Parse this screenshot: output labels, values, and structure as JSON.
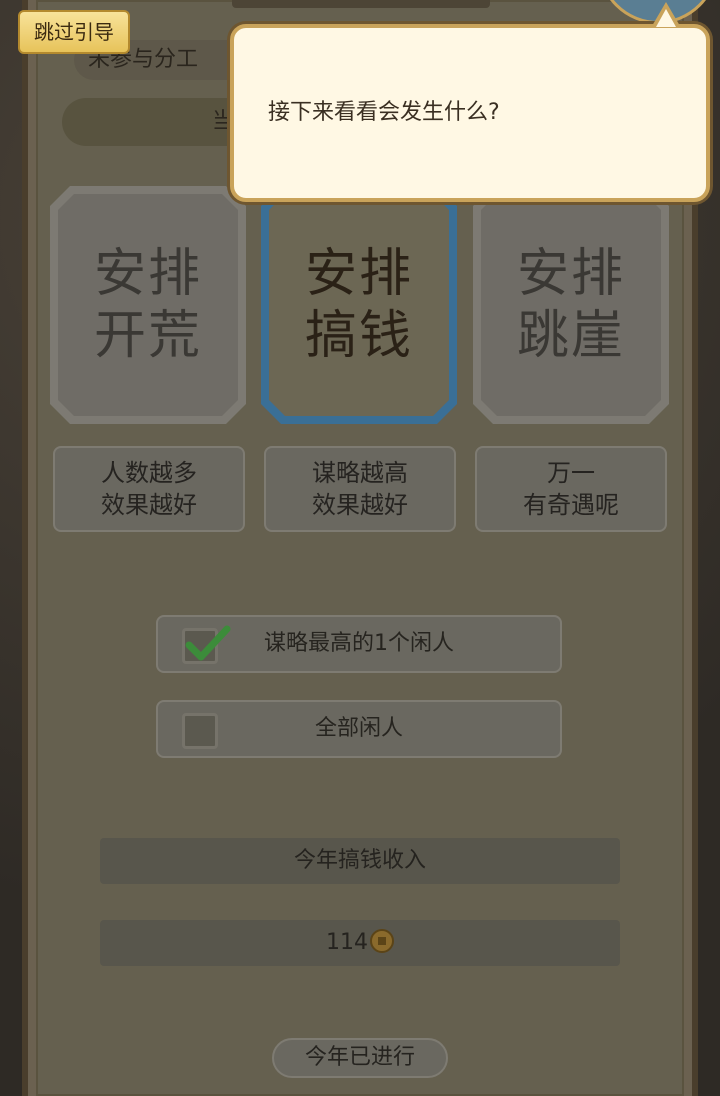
{
  "skip_guide": "跳过引导",
  "dialog": {
    "text": "接下来看看会发生什么?"
  },
  "header": {
    "banner_text": "未参与分工",
    "pill_text": "当"
  },
  "cards": [
    {
      "line1": "安排",
      "line2": "开荒",
      "selected": false
    },
    {
      "line1": "安排",
      "line2": "搞钱",
      "selected": true
    },
    {
      "line1": "安排",
      "line2": "跳崖",
      "selected": false
    }
  ],
  "descriptions": [
    {
      "line1": "人数越多",
      "line2": "效果越好"
    },
    {
      "line1": "谋略越高",
      "line2": "效果越好"
    },
    {
      "line1": "万一",
      "line2": "有奇遇呢"
    }
  ],
  "options": [
    {
      "label": "谋略最高的1个闲人",
      "checked": true
    },
    {
      "label": "全部闲人",
      "checked": false
    }
  ],
  "income": {
    "label": "今年搞钱收入",
    "value": "114",
    "icon": "coin-icon"
  },
  "progress": {
    "label": "今年已进行"
  },
  "colors": {
    "selected_border": "#3a6f96",
    "skip_button": "#f8e39a",
    "dialog_bg": "#fff8e4",
    "check_green": "#3c8c3a"
  }
}
